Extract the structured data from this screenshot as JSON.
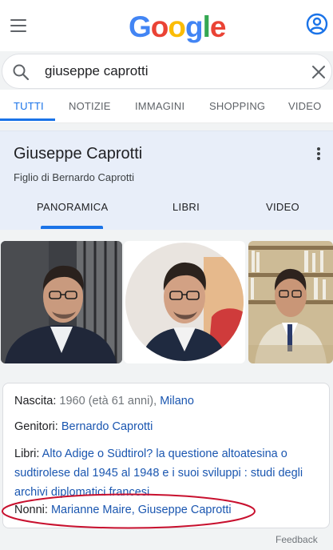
{
  "logo": [
    "G",
    "o",
    "o",
    "g",
    "l",
    "e"
  ],
  "search": {
    "query": "giuseppe caprotti"
  },
  "tabs": [
    "TUTTI",
    "NOTIZIE",
    "IMMAGINI",
    "SHOPPING",
    "VIDEO"
  ],
  "knowledge_panel": {
    "title": "Giuseppe Caprotti",
    "subtitle": "Figlio di Bernardo Caprotti",
    "tabs": [
      "PANORAMICA",
      "LIBRI",
      "VIDEO"
    ]
  },
  "facts": {
    "nascita": {
      "label": "Nascita: ",
      "value": "1960 (età 61 anni), ",
      "link": "Milano"
    },
    "genitori": {
      "label": "Genitori: ",
      "link": "Bernardo Caprotti"
    },
    "libri": {
      "label": "Libri: ",
      "link": "Alto Adige o Südtirol? la questione altoatesina o sudtirolese dal 1945 al 1948 e i suoi sviluppi : studi degli archivi diplomatici francesi"
    },
    "nonni": {
      "label": "Nonni: ",
      "link": "Marianne Maire, Giuseppe Caprotti"
    }
  },
  "footer": {
    "feedback": "Feedback"
  },
  "colors": {
    "accent": "#1a73e8",
    "link": "#1a56b0",
    "highlight_oval": "#c8102e"
  }
}
